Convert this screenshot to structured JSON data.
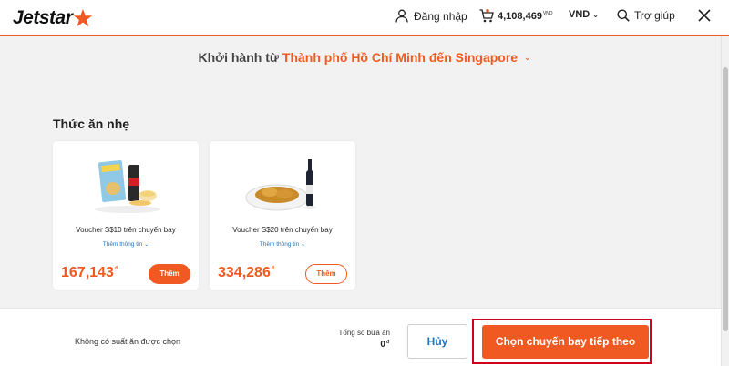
{
  "header": {
    "logo_text": "Jetstar",
    "login_label": "Đăng nhập",
    "cart_amount": "4,108,469",
    "cart_currency": "VND",
    "currency_label": "VND",
    "help_label": "Trợ giúp",
    "brand_color": "#f05a22"
  },
  "route": {
    "prefix": "Khởi hành từ",
    "destination": "Thành phố Hồ Chí Minh đến Singapore"
  },
  "section": {
    "title": "Thức ăn nhẹ",
    "items": [
      {
        "title": "Voucher S$10 trên chuyến bay",
        "more_label": "Thêm thông tin",
        "price": "167,143",
        "currency": "đ",
        "button_label": "Thêm"
      },
      {
        "title": "Voucher S$20 trên chuyến bay",
        "more_label": "Thêm thông tin",
        "price": "334,286",
        "currency": "đ",
        "button_label": "Thêm"
      }
    ]
  },
  "footer": {
    "no_meal_text": "Không có suất ăn được chọn",
    "total_label": "Tổng số bữa ăn",
    "total_value": "0",
    "total_currency": "đ",
    "cancel_label": "Hủy",
    "next_label": "Chọn chuyến bay tiếp theo"
  }
}
